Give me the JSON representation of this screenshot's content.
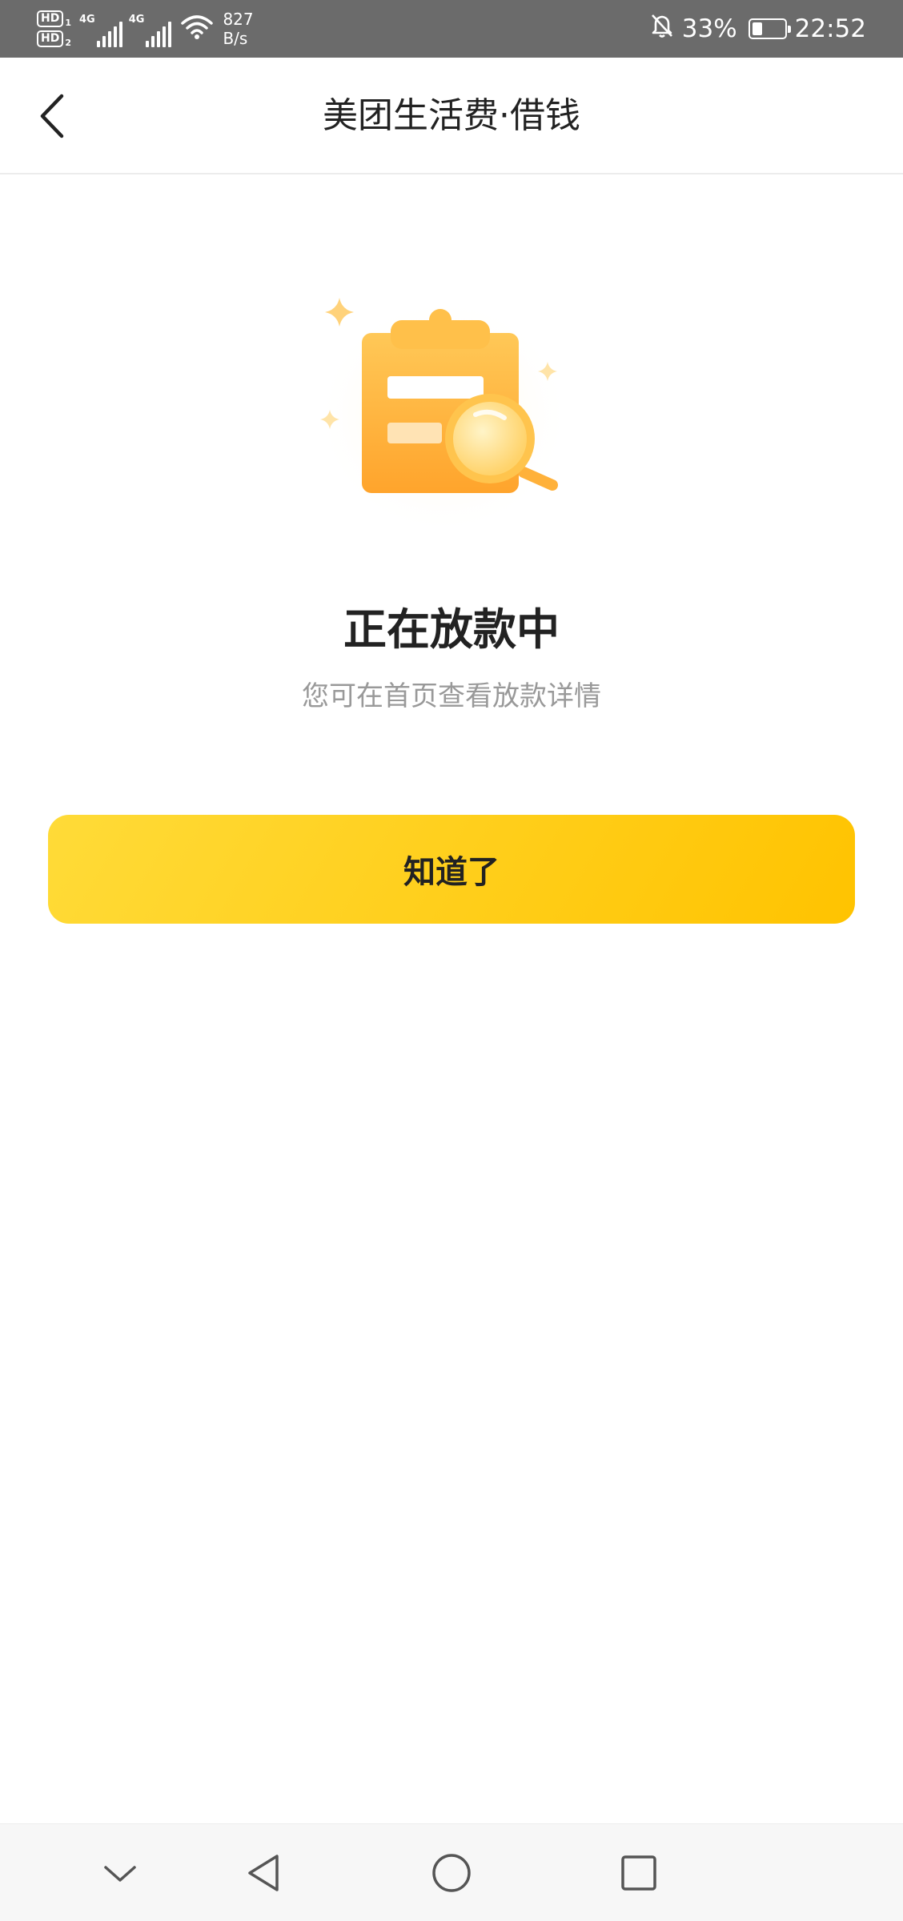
{
  "status_bar": {
    "sim1_tag": "HD",
    "sim1_sub": "1",
    "sim2_tag": "HD",
    "sim2_sub": "2",
    "net1": "4G",
    "net2": "4G",
    "speed_value": "827",
    "speed_unit": "B/s",
    "battery_percent": "33%",
    "battery_level": 0.33,
    "time": "22:52",
    "icons": [
      "signal-icon",
      "wifi-icon",
      "bell-off-icon",
      "battery-icon"
    ]
  },
  "header": {
    "title": "美团生活费·借钱",
    "back_icon": "chevron-left-icon"
  },
  "main": {
    "illustration_icon": "clipboard-search-icon",
    "status_title": "正在放款中",
    "status_desc": "您可在首页查看放款详情",
    "ok_button": "知道了"
  },
  "nav_bar": {
    "items": [
      "collapse-icon",
      "back-icon",
      "home-icon",
      "recents-icon"
    ]
  },
  "colors": {
    "accent_start": "#ffdb38",
    "accent_end": "#ffc300",
    "illustration_orange": "#ffad38",
    "title_text": "#222222",
    "desc_text": "#999999"
  }
}
